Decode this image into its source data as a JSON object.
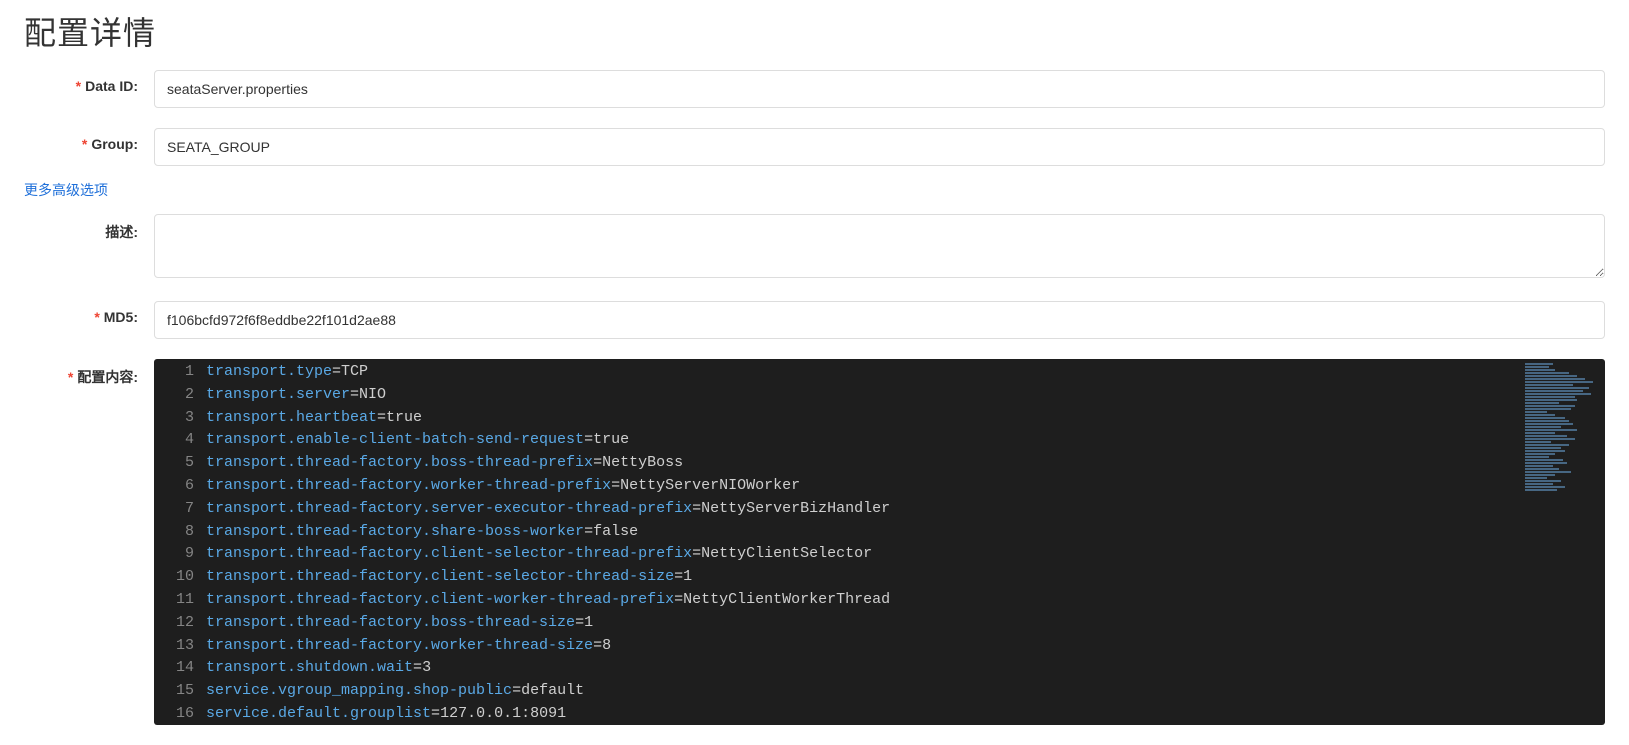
{
  "title": "配置详情",
  "labels": {
    "data_id": "Data ID:",
    "group": "Group:",
    "description": "描述:",
    "md5": "MD5:",
    "config_content": "配置内容:"
  },
  "fields": {
    "data_id": "seataServer.properties",
    "group": "SEATA_GROUP",
    "description": "",
    "md5": "f106bcfd972f6f8eddbe22f101d2ae88"
  },
  "advanced_link": "更多高级选项",
  "config_content": {
    "lines": [
      {
        "key": "transport.type",
        "value": "TCP"
      },
      {
        "key": "transport.server",
        "value": "NIO"
      },
      {
        "key": "transport.heartbeat",
        "value": "true"
      },
      {
        "key": "transport.enable-client-batch-send-request",
        "value": "true"
      },
      {
        "key": "transport.thread-factory.boss-thread-prefix",
        "value": "NettyBoss"
      },
      {
        "key": "transport.thread-factory.worker-thread-prefix",
        "value": "NettyServerNIOWorker"
      },
      {
        "key": "transport.thread-factory.server-executor-thread-prefix",
        "value": "NettyServerBizHandler"
      },
      {
        "key": "transport.thread-factory.share-boss-worker",
        "value": "false"
      },
      {
        "key": "transport.thread-factory.client-selector-thread-prefix",
        "value": "NettyClientSelector"
      },
      {
        "key": "transport.thread-factory.client-selector-thread-size",
        "value": "1"
      },
      {
        "key": "transport.thread-factory.client-worker-thread-prefix",
        "value": "NettyClientWorkerThread"
      },
      {
        "key": "transport.thread-factory.boss-thread-size",
        "value": "1"
      },
      {
        "key": "transport.thread-factory.worker-thread-size",
        "value": "8"
      },
      {
        "key": "transport.shutdown.wait",
        "value": "3"
      },
      {
        "key": "service.vgroup_mapping.shop-public",
        "value": "default"
      },
      {
        "key": "service.default.grouplist",
        "value": "127.0.0.1:8091"
      }
    ]
  },
  "minimap_widths": [
    28,
    24,
    30,
    44,
    52,
    60,
    68,
    48,
    64,
    58,
    66,
    50,
    52,
    34,
    50,
    46,
    22,
    30,
    40,
    44,
    48,
    36,
    52,
    30,
    42,
    50,
    26,
    44,
    36,
    40,
    30,
    24,
    38,
    42,
    28,
    34,
    46,
    30,
    22,
    36,
    28,
    40,
    32
  ]
}
